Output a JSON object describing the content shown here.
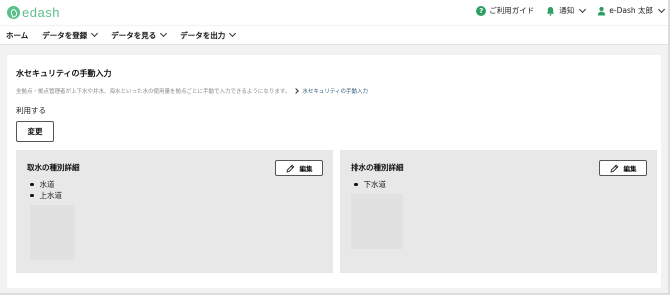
{
  "header": {
    "logo_text": "edash",
    "help_label": "ご利用ガイド",
    "help_icon_glyph": "?",
    "notification_label": "通知",
    "user_name": "e-Dash 太郎",
    "accent_color": "#5bbf8c"
  },
  "nav": {
    "items": [
      {
        "label": "ホーム",
        "has_dropdown": false
      },
      {
        "label": "データを登録",
        "has_dropdown": true
      },
      {
        "label": "データを見る",
        "has_dropdown": true
      },
      {
        "label": "データを出力",
        "has_dropdown": true
      }
    ]
  },
  "page": {
    "title": "水セキュリティの手動入力",
    "description": "全拠点・拠点管理者が上下水や井水、海水といった水の使用量を拠点ごとに手動で入力できるようになります。",
    "description_link": "水セキュリティの手動入力",
    "status": "利用する",
    "change_button": "変更"
  },
  "cards": [
    {
      "title": "取水の種別詳細",
      "edit_label": "編集",
      "items": [
        "水道",
        "上水道"
      ]
    },
    {
      "title": "排水の種別詳細",
      "edit_label": "編集",
      "items": [
        "下水道"
      ]
    }
  ]
}
